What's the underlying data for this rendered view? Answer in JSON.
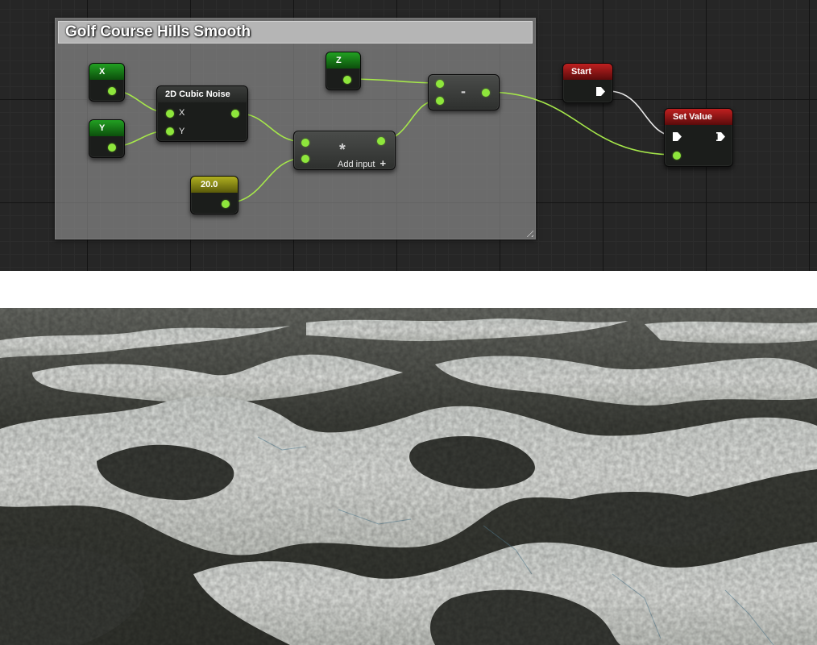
{
  "comment": {
    "title": "Golf Course Hills Smooth"
  },
  "nodes": {
    "x": {
      "title": "X"
    },
    "y": {
      "title": "Y"
    },
    "noise": {
      "title": "2D Cubic Noise",
      "pin_x": "X",
      "pin_y": "Y"
    },
    "const": {
      "title": "20.0"
    },
    "z": {
      "title": "Z"
    },
    "multiply": {
      "symbol": "*",
      "add_input": "Add input",
      "add_icon": "+"
    },
    "subtract": {
      "symbol": "-"
    },
    "start": {
      "title": "Start"
    },
    "set_value": {
      "title": "Set Value"
    }
  },
  "colors": {
    "data_pin": "#8ee63c",
    "variable_header": "#1a8a1a",
    "constant_header": "#9a9a14",
    "event_header": "#a01818"
  },
  "render": {
    "description_icon": "terrain-render-image"
  }
}
